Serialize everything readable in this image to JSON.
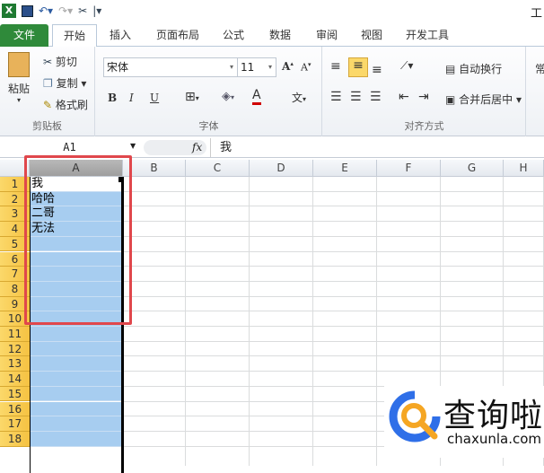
{
  "qat": {
    "icons": [
      "excel-icon",
      "save-icon",
      "undo-icon",
      "redo-icon",
      "tools-icon",
      "customize-icon"
    ],
    "title_fragment": "工"
  },
  "tabs": [
    "文件",
    "开始",
    "插入",
    "页面布局",
    "公式",
    "数据",
    "审阅",
    "视图",
    "开发工具"
  ],
  "ribbon": {
    "clipboard": {
      "paste": "粘贴",
      "cut": "剪切",
      "copy": "复制",
      "format_painter": "格式刷",
      "label": "剪贴板"
    },
    "font": {
      "font_name": "宋体",
      "font_size": "11",
      "bold": "B",
      "italic": "I",
      "underline": "U",
      "label": "字体",
      "font_color": "#d00000"
    },
    "alignment": {
      "wrap_text": "自动换行",
      "merge_center": "合并后居中",
      "label": "对齐方式"
    },
    "number": {
      "fragment": "常"
    }
  },
  "formula_bar": {
    "name_box": "A1",
    "fx": "fx",
    "value": "我"
  },
  "sheet": {
    "columns": [
      "A",
      "B",
      "C",
      "D",
      "E",
      "F",
      "G",
      "H"
    ],
    "rows": [
      "1",
      "2",
      "3",
      "4",
      "5",
      "6",
      "7",
      "8",
      "9",
      "10",
      "11",
      "12",
      "13",
      "14",
      "15",
      "16",
      "17",
      "18"
    ],
    "column_a": [
      "我",
      "哈哈",
      "二哥",
      "无法"
    ],
    "selected_column": "A",
    "active_cell": "A1",
    "selection_color": "#a7cdf0",
    "highlight_color": "#e0474c"
  },
  "watermark": {
    "brand": "查询啦",
    "url": "chaxunla.com"
  }
}
